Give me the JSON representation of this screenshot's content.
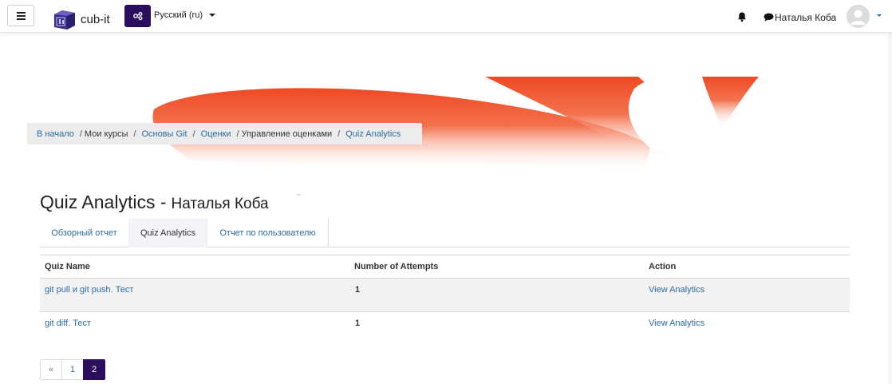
{
  "navbar": {
    "site_name": "cub-it",
    "language": "Русский (ru)",
    "user_name": "Наталья Коба",
    "icons": {
      "menu": "hamburger-icon",
      "logo": "cube-logo",
      "language": "language-icon",
      "notifications": "bell-icon",
      "messages": "chat-icon",
      "avatar": "user-avatar",
      "user_menu": "caret-down-icon"
    }
  },
  "breadcrumb": {
    "items": [
      {
        "label": "В начало",
        "link": true
      },
      {
        "label": "Мои курсы",
        "link": false
      },
      {
        "label": "Основы Git",
        "link": true
      },
      {
        "label": "Оценки",
        "link": true
      },
      {
        "label": "Управление оценками",
        "link": false
      },
      {
        "label": "Quiz Analytics",
        "link": true
      }
    ],
    "separator": "/"
  },
  "page": {
    "title": "Quiz Analytics -",
    "user": "Наталья Коба"
  },
  "tabs": [
    {
      "label": "Обзорный отчет",
      "active": false
    },
    {
      "label": "Quiz Analytics",
      "active": true
    },
    {
      "label": "Отчет по пользователю",
      "active": false
    }
  ],
  "table": {
    "headers": [
      "Quiz Name",
      "Number of Attempts",
      "Action"
    ],
    "rows": [
      {
        "quiz": "git pull и git push. Тест",
        "attempts": "1",
        "action": "View Analytics"
      },
      {
        "quiz": "git diff. Тест",
        "attempts": "1",
        "action": "View Analytics"
      }
    ]
  },
  "pagination": {
    "prev": "«",
    "pages": [
      "1",
      "2"
    ],
    "current": "2"
  },
  "colors": {
    "brand": "#2b0f5c",
    "link": "#2c6aa0",
    "banner": "#f0542d"
  }
}
